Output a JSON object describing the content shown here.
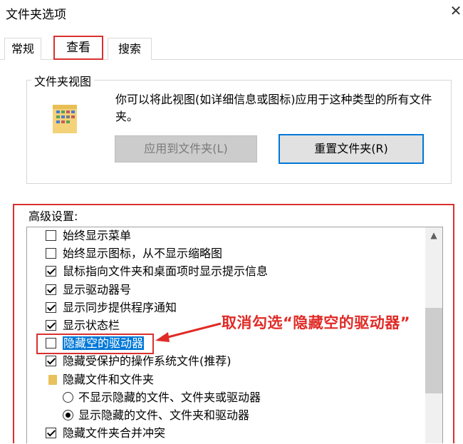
{
  "window": {
    "title": "文件夹选项",
    "close_glyph": "✕"
  },
  "tabs": [
    {
      "label": "常规"
    },
    {
      "label": "查看"
    },
    {
      "label": "搜索"
    }
  ],
  "folder_views": {
    "legend": "文件夹视图",
    "description": "你可以将此视图(如详细信息或图标)应用于这种类型的所有文件夹。",
    "apply_button": "应用到文件夹(L)",
    "reset_button": "重置文件夹(R)"
  },
  "advanced": {
    "label": "高级设置:",
    "items": [
      {
        "type": "checkbox",
        "checked": false,
        "label": "始终显示菜单"
      },
      {
        "type": "checkbox",
        "checked": false,
        "label": "始终显示图标，从不显示缩略图"
      },
      {
        "type": "checkbox",
        "checked": true,
        "label": "鼠标指向文件夹和桌面项时显示提示信息"
      },
      {
        "type": "checkbox",
        "checked": true,
        "label": "显示驱动器号"
      },
      {
        "type": "checkbox",
        "checked": true,
        "label": "显示同步提供程序通知"
      },
      {
        "type": "checkbox",
        "checked": true,
        "label": "显示状态栏"
      },
      {
        "type": "checkbox",
        "checked": false,
        "label": "隐藏空的驱动器"
      },
      {
        "type": "checkbox",
        "checked": true,
        "label": "隐藏受保护的操作系统文件(推荐)"
      },
      {
        "type": "folder",
        "label": "隐藏文件和文件夹"
      },
      {
        "type": "radio",
        "selected": false,
        "label": "不显示隐藏的文件、文件夹或驱动器"
      },
      {
        "type": "radio",
        "selected": true,
        "label": "显示隐藏的文件、文件夹和驱动器"
      },
      {
        "type": "checkbox",
        "checked": true,
        "label": "隐藏文件夹合并冲突"
      }
    ]
  },
  "annotation": {
    "text": "取消勾选“隐藏空的驱动器”"
  },
  "colors": {
    "highlight_red": "#d9312f",
    "selection_blue": "#0078d7",
    "focus_blue": "#0078d7"
  }
}
